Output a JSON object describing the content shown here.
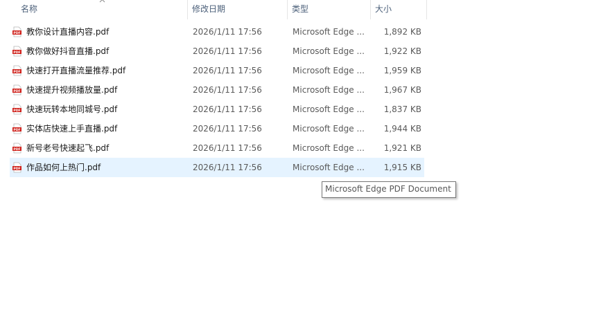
{
  "columns": {
    "name": "名称",
    "date": "修改日期",
    "type": "类型",
    "size": "大小"
  },
  "files": [
    {
      "name": "教你设计直播内容.pdf",
      "date": "2026/1/11 17:56",
      "type": "Microsoft Edge ...",
      "size": "1,892 KB"
    },
    {
      "name": "教你做好抖音直播.pdf",
      "date": "2026/1/11 17:56",
      "type": "Microsoft Edge ...",
      "size": "1,922 KB"
    },
    {
      "name": "快速打开直播流量推荐.pdf",
      "date": "2026/1/11 17:56",
      "type": "Microsoft Edge ...",
      "size": "1,959 KB"
    },
    {
      "name": "快速提升视频播放量.pdf",
      "date": "2026/1/11 17:56",
      "type": "Microsoft Edge ...",
      "size": "1,967 KB"
    },
    {
      "name": "快速玩转本地同城号.pdf",
      "date": "2026/1/11 17:56",
      "type": "Microsoft Edge ...",
      "size": "1,837 KB"
    },
    {
      "name": "实体店快速上手直播.pdf",
      "date": "2026/1/11 17:56",
      "type": "Microsoft Edge ...",
      "size": "1,944 KB"
    },
    {
      "name": "新号老号快速起飞.pdf",
      "date": "2026/1/11 17:56",
      "type": "Microsoft Edge ...",
      "size": "1,921 KB"
    },
    {
      "name": "作品如何上热门.pdf",
      "date": "2026/1/11 17:56",
      "type": "Microsoft Edge ...",
      "size": "1,915 KB"
    }
  ],
  "hovered_row": 7,
  "tooltip": "Microsoft Edge PDF Document",
  "icon": "pdf-file-icon",
  "colors": {
    "header_text": "#4c607a",
    "hover_bg": "#e5f3ff",
    "pdf_red": "#d0201a"
  }
}
